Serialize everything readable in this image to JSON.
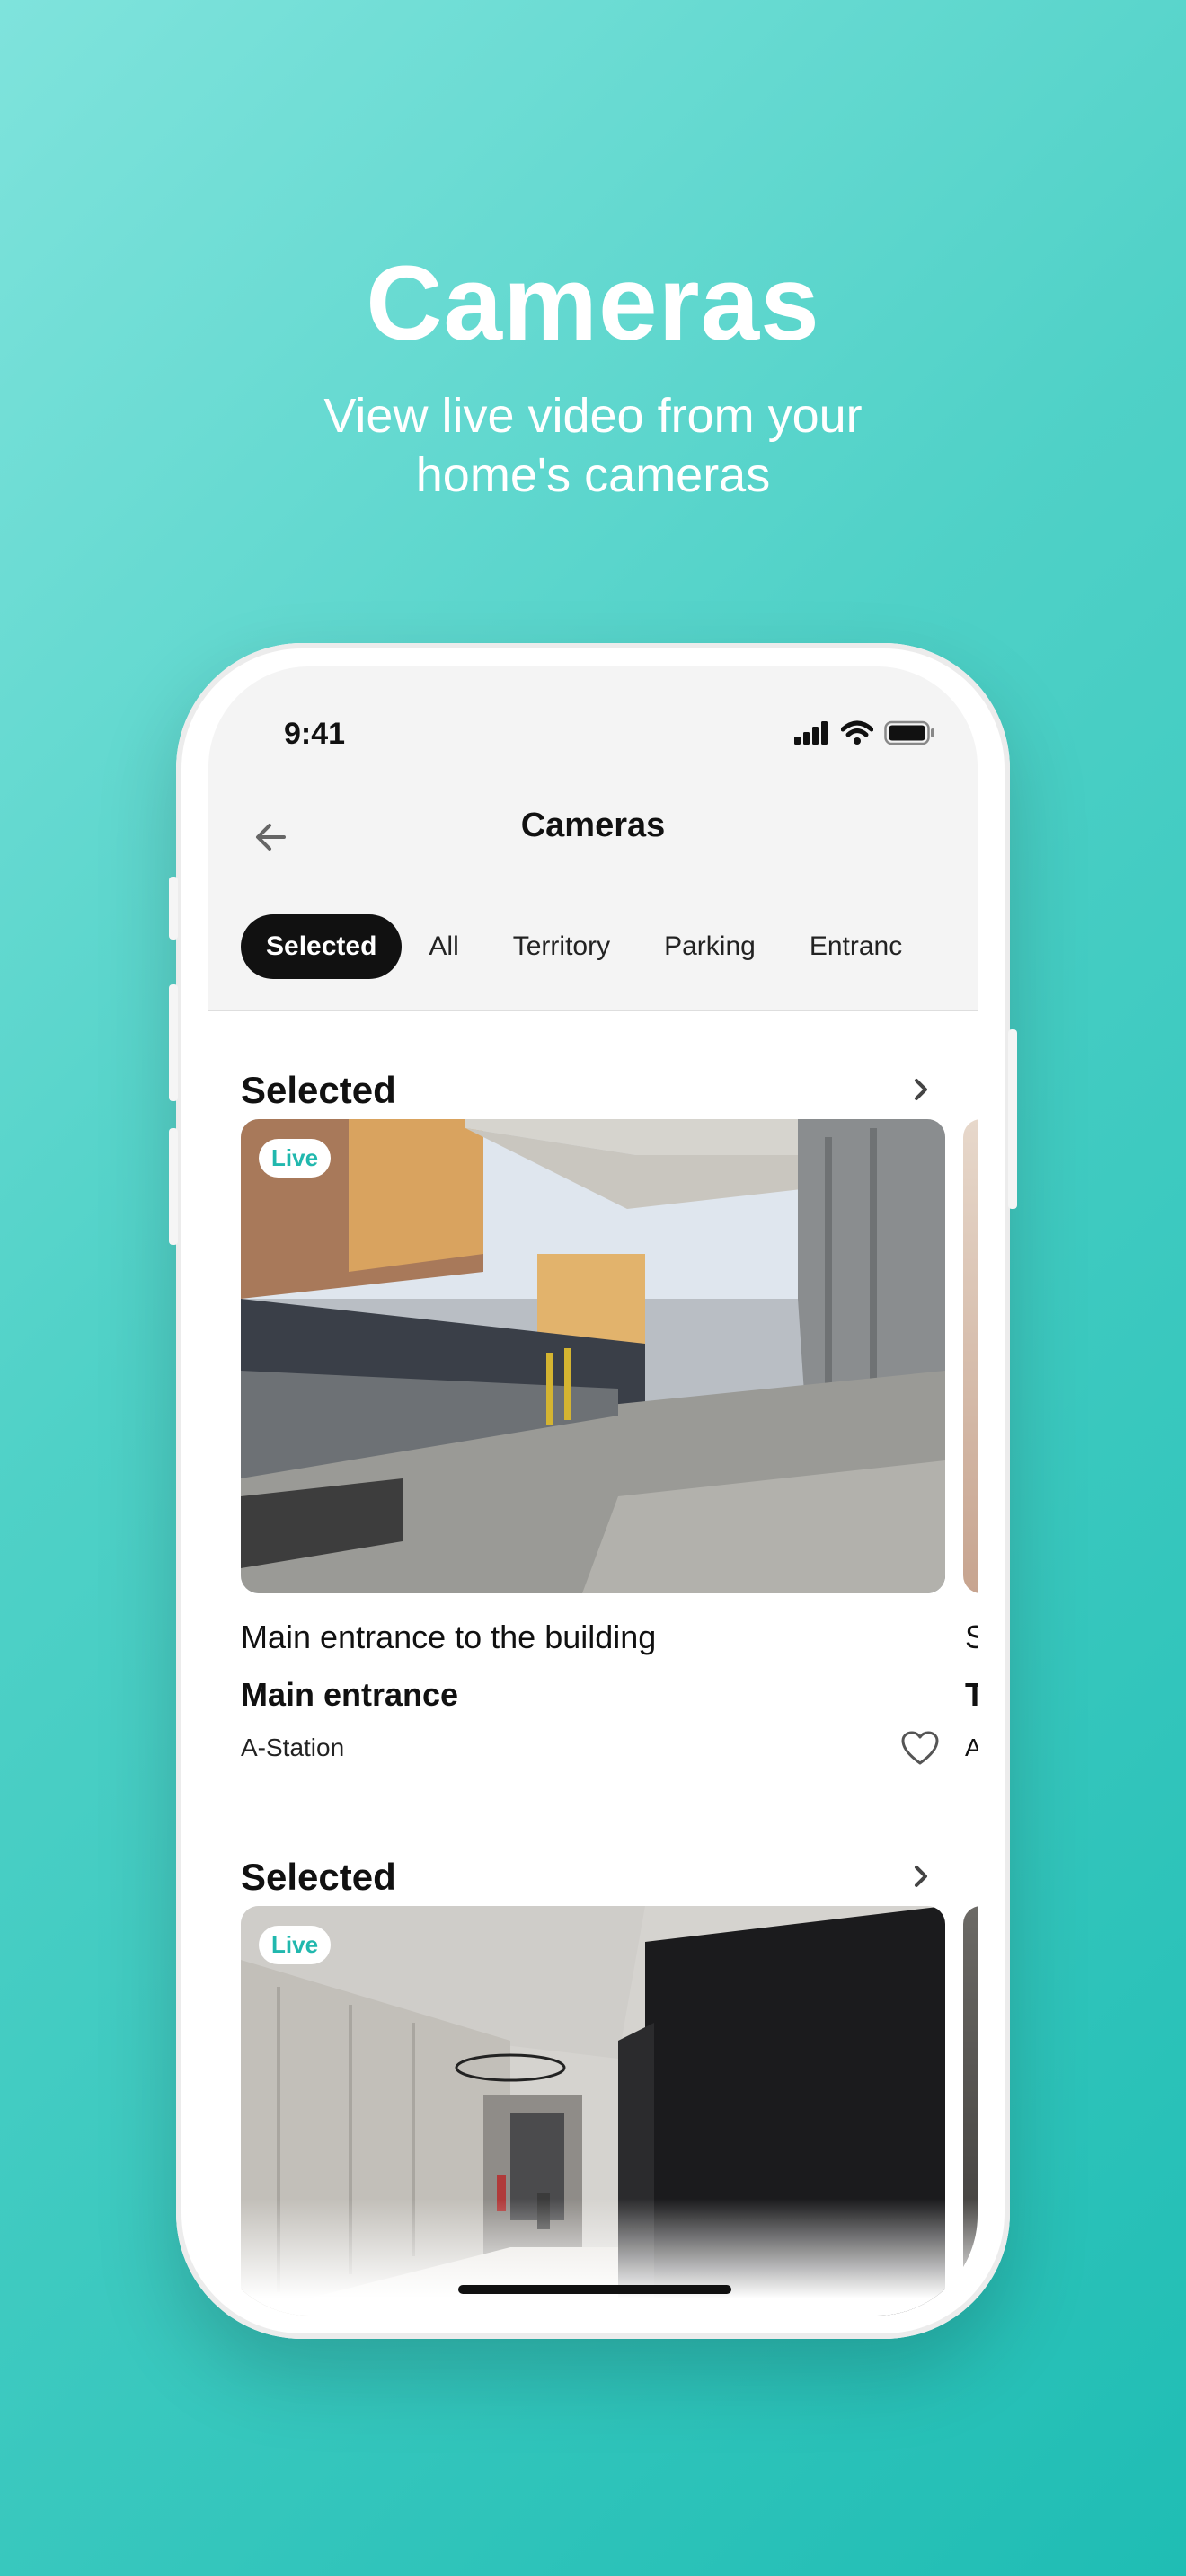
{
  "promo": {
    "title": "Cameras",
    "subtitle_line1": "View live video from your",
    "subtitle_line2": "home's cameras"
  },
  "status_bar": {
    "time": "9:41"
  },
  "header": {
    "title": "Cameras",
    "back_icon": "arrow-left-icon"
  },
  "tabs": [
    {
      "label": "Selected",
      "active": true
    },
    {
      "label": "All",
      "active": false
    },
    {
      "label": "Territory",
      "active": false
    },
    {
      "label": "Parking",
      "active": false
    },
    {
      "label": "Entranc",
      "active": false
    }
  ],
  "sections": [
    {
      "title": "Selected",
      "card": {
        "badge": "Live",
        "description": "Main entrance to the building",
        "name": "Main entrance",
        "location": "A-Station",
        "favorite": false
      },
      "peek": {
        "line1": "S",
        "line2": "T",
        "line3": "A"
      }
    },
    {
      "title": "Selected",
      "card": {
        "badge": "Live"
      }
    }
  ],
  "colors": {
    "accent": "#21b8ae",
    "background_start": "#7fe3dc",
    "background_end": "#1fbdb4"
  }
}
